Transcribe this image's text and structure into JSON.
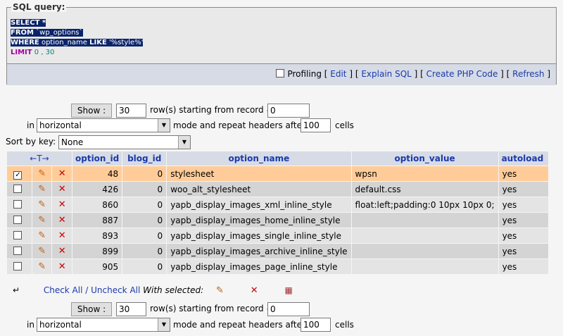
{
  "sql_box": {
    "legend": "SQL query:",
    "line1": "SELECT *",
    "line2_kw": "FROM",
    "line2_rest": " `wp_options`",
    "line3_kw": "WHERE",
    "line3_rest": " option_name ",
    "line3_kw2": "LIKE",
    "line3_str": " '%style%'",
    "line4_kw": "LIMIT",
    "line4_nums": " 0 , 30",
    "profiling": "Profiling",
    "edit": "Edit",
    "explain": "Explain SQL",
    "create_php": "Create PHP Code",
    "refresh": "Refresh"
  },
  "nav_top": {
    "show_label": "Show :",
    "rows_value": "30",
    "rows_text": "row(s) starting from record #",
    "start_value": "0",
    "in_text": "in",
    "mode_value": "horizontal",
    "mode_text": "mode and repeat headers after",
    "repeat_value": "100",
    "cells_text": "cells"
  },
  "sort": {
    "label": "Sort by key:",
    "value": "None"
  },
  "table": {
    "nav_arrows": "←T→",
    "headers": [
      "option_id",
      "blog_id",
      "option_name",
      "option_value",
      "autoload"
    ],
    "rows": [
      {
        "id": "48",
        "blog": "0",
        "name": "stylesheet",
        "value": "wpsn",
        "autoload": "yes"
      },
      {
        "id": "426",
        "blog": "0",
        "name": "woo_alt_stylesheet",
        "value": "default.css",
        "autoload": "yes"
      },
      {
        "id": "860",
        "blog": "0",
        "name": "yapb_display_images_xml_inline_style",
        "value": "float:left;padding:0 10px 10px 0;",
        "autoload": "yes"
      },
      {
        "id": "887",
        "blog": "0",
        "name": "yapb_display_images_home_inline_style",
        "value": "",
        "autoload": "yes"
      },
      {
        "id": "893",
        "blog": "0",
        "name": "yapb_display_images_single_inline_style",
        "value": "",
        "autoload": "yes"
      },
      {
        "id": "899",
        "blog": "0",
        "name": "yapb_display_images_archive_inline_style",
        "value": "",
        "autoload": "yes"
      },
      {
        "id": "905",
        "blog": "0",
        "name": "yapb_display_images_page_inline_style",
        "value": "",
        "autoload": "yes"
      }
    ]
  },
  "bottom": {
    "check_all": "Check All",
    "sep": " / ",
    "uncheck_all": "Uncheck All",
    "with_selected": "With selected:"
  },
  "nav_bottom": {
    "show_label": "Show :",
    "rows_value": "30",
    "rows_text": "row(s) starting from record #",
    "start_value": "0",
    "in_text": "in",
    "mode_value": "horizontal",
    "mode_text": "mode and repeat headers after",
    "repeat_value": "100",
    "cells_text": "cells"
  },
  "icons": {
    "edit": "pencil-icon",
    "delete": "delete-icon",
    "export": "export-icon",
    "arrow": "arrow-up-left-icon"
  },
  "colors": {
    "header_bg": "#d7dbe6",
    "marked_row": "#ffcc99",
    "link": "#1a3aaa"
  }
}
